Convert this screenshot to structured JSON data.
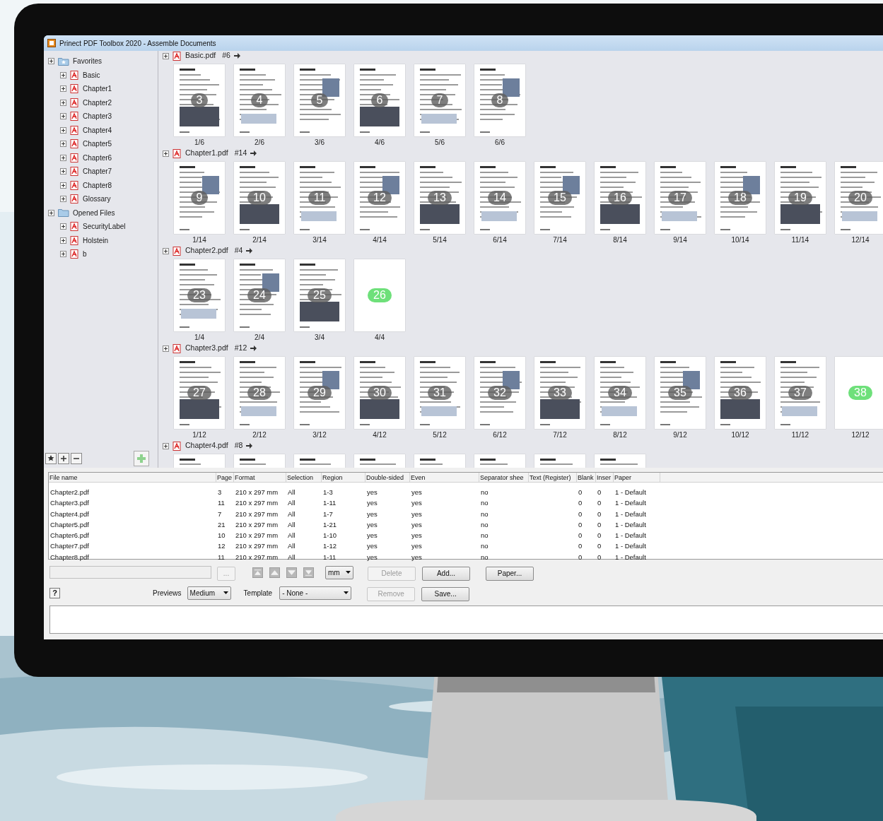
{
  "window": {
    "title": "Prinect PDF Toolbox 2020 - Assemble Documents"
  },
  "sidebar": {
    "items": [
      {
        "label": "Favorites",
        "kind": "folder",
        "children": [
          {
            "label": "Basic",
            "kind": "pdf"
          },
          {
            "label": "Chapter1",
            "kind": "pdf"
          },
          {
            "label": "Chapter2",
            "kind": "pdf"
          },
          {
            "label": "Chapter3",
            "kind": "pdf"
          },
          {
            "label": "Chapter4",
            "kind": "pdf"
          },
          {
            "label": "Chapter5",
            "kind": "pdf"
          },
          {
            "label": "Chapter6",
            "kind": "pdf"
          },
          {
            "label": "Chapter7",
            "kind": "pdf"
          },
          {
            "label": "Chapter8",
            "kind": "pdf"
          },
          {
            "label": "Glossary",
            "kind": "pdf"
          }
        ]
      },
      {
        "label": "Opened Files",
        "kind": "folder",
        "children": [
          {
            "label": "SecurityLabel",
            "kind": "pdf"
          },
          {
            "label": "Holstein",
            "kind": "pdf"
          },
          {
            "label": "b",
            "kind": "pdf"
          }
        ]
      }
    ]
  },
  "documents": [
    {
      "name": "Basic.pdf",
      "count": "#6",
      "pages": [
        {
          "kind": "page",
          "number": "3",
          "label": "1/6"
        },
        {
          "kind": "page",
          "number": "4",
          "label": "2/6"
        },
        {
          "kind": "page",
          "number": "5",
          "label": "3/6"
        },
        {
          "kind": "page",
          "number": "6",
          "label": "4/6"
        },
        {
          "kind": "page",
          "number": "7",
          "label": "5/6"
        },
        {
          "kind": "page",
          "number": "8",
          "label": "6/6"
        }
      ]
    },
    {
      "name": "Chapter1.pdf",
      "count": "#14",
      "pages": [
        {
          "kind": "page",
          "number": "9",
          "label": "1/14"
        },
        {
          "kind": "page",
          "number": "10",
          "label": "2/14"
        },
        {
          "kind": "page",
          "number": "11",
          "label": "3/14"
        },
        {
          "kind": "page",
          "number": "12",
          "label": "4/14"
        },
        {
          "kind": "page",
          "number": "13",
          "label": "5/14"
        },
        {
          "kind": "page",
          "number": "14",
          "label": "6/14"
        },
        {
          "kind": "page",
          "number": "15",
          "label": "7/14"
        },
        {
          "kind": "page",
          "number": "16",
          "label": "8/14"
        },
        {
          "kind": "page",
          "number": "17",
          "label": "9/14"
        },
        {
          "kind": "page",
          "number": "18",
          "label": "10/14"
        },
        {
          "kind": "page",
          "number": "19",
          "label": "11/14"
        },
        {
          "kind": "page",
          "number": "20",
          "label": "12/14"
        }
      ]
    },
    {
      "name": "Chapter2.pdf",
      "count": "#4",
      "pages": [
        {
          "kind": "page",
          "number": "23",
          "label": "1/4"
        },
        {
          "kind": "page",
          "number": "24",
          "label": "2/4"
        },
        {
          "kind": "page",
          "number": "25",
          "label": "3/4"
        },
        {
          "kind": "blank",
          "number": "26",
          "label": "4/4"
        }
      ]
    },
    {
      "name": "Chapter3.pdf",
      "count": "#12",
      "pages": [
        {
          "kind": "page",
          "number": "27",
          "label": "1/12"
        },
        {
          "kind": "page",
          "number": "28",
          "label": "2/12"
        },
        {
          "kind": "page",
          "number": "29",
          "label": "3/12"
        },
        {
          "kind": "page",
          "number": "30",
          "label": "4/12"
        },
        {
          "kind": "page",
          "number": "31",
          "label": "5/12"
        },
        {
          "kind": "page",
          "number": "32",
          "label": "6/12"
        },
        {
          "kind": "page",
          "number": "33",
          "label": "7/12"
        },
        {
          "kind": "page",
          "number": "34",
          "label": "8/12"
        },
        {
          "kind": "page",
          "number": "35",
          "label": "9/12"
        },
        {
          "kind": "page",
          "number": "36",
          "label": "10/12"
        },
        {
          "kind": "page",
          "number": "37",
          "label": "11/12"
        },
        {
          "kind": "blank",
          "number": "38",
          "label": "12/12"
        }
      ]
    },
    {
      "name": "Chapter4.pdf",
      "count": "#8",
      "pages": [
        {
          "kind": "cut"
        },
        {
          "kind": "cut"
        },
        {
          "kind": "cut"
        },
        {
          "kind": "cut"
        },
        {
          "kind": "cut"
        },
        {
          "kind": "cut"
        },
        {
          "kind": "cut"
        },
        {
          "kind": "cut"
        }
      ]
    }
  ],
  "table": {
    "columns": [
      "File name",
      "Page",
      "Format",
      "Selection",
      "Region",
      "Double-sided",
      "Even",
      "Separator shee",
      "Text (Register)",
      "Blank",
      "Inser",
      "Paper"
    ],
    "rows": [
      {
        "file_name": "Chapter2.pdf",
        "page": "3",
        "format": "210 x 297 mm",
        "selection": "All",
        "region": "1-3",
        "double_sided": "yes",
        "even": "yes",
        "separator_sheet": "no",
        "blank": "0",
        "insert": "0",
        "paper": "1 - Default"
      },
      {
        "file_name": "Chapter3.pdf",
        "page": "11",
        "format": "210 x 297 mm",
        "selection": "All",
        "region": "1-11",
        "double_sided": "yes",
        "even": "yes",
        "separator_sheet": "no",
        "blank": "0",
        "insert": "0",
        "paper": "1 - Default"
      },
      {
        "file_name": "Chapter4.pdf",
        "page": "7",
        "format": "210 x 297 mm",
        "selection": "All",
        "region": "1-7",
        "double_sided": "yes",
        "even": "yes",
        "separator_sheet": "no",
        "blank": "0",
        "insert": "0",
        "paper": "1 - Default"
      },
      {
        "file_name": "Chapter5.pdf",
        "page": "21",
        "format": "210 x 297 mm",
        "selection": "All",
        "region": "1-21",
        "double_sided": "yes",
        "even": "yes",
        "separator_sheet": "no",
        "blank": "0",
        "insert": "0",
        "paper": "1 - Default"
      },
      {
        "file_name": "Chapter6.pdf",
        "page": "10",
        "format": "210 x 297 mm",
        "selection": "All",
        "region": "1-10",
        "double_sided": "yes",
        "even": "yes",
        "separator_sheet": "no",
        "blank": "0",
        "insert": "0",
        "paper": "1 - Default"
      },
      {
        "file_name": "Chapter7.pdf",
        "page": "12",
        "format": "210 x 297 mm",
        "selection": "All",
        "region": "1-12",
        "double_sided": "yes",
        "even": "yes",
        "separator_sheet": "no",
        "blank": "0",
        "insert": "0",
        "paper": "1 - Default"
      },
      {
        "file_name": "Chapter8.pdf",
        "page": "11",
        "format": "210 x 297 mm",
        "selection": "All",
        "region": "1-11",
        "double_sided": "yes",
        "even": "yes",
        "separator_sheet": "no",
        "blank": "0",
        "insert": "0",
        "paper": "1 - Default"
      }
    ]
  },
  "controls": {
    "browse_button": {
      "label": "...",
      "disabled": true
    },
    "unit_select": {
      "value": "mm"
    },
    "delete_button": {
      "label": "Delete",
      "disabled": true
    },
    "add_button": {
      "label": "Add...",
      "disabled": false
    },
    "paper_button": {
      "label": "Paper...",
      "disabled": false
    },
    "help_button": {
      "label": "?"
    },
    "previews": {
      "label": "Previews",
      "value": "Medium"
    },
    "template": {
      "label": "Template",
      "value": "- None -"
    },
    "remove_button": {
      "label": "Remove",
      "disabled": true
    },
    "save_button": {
      "label": "Save...",
      "disabled": false
    }
  }
}
